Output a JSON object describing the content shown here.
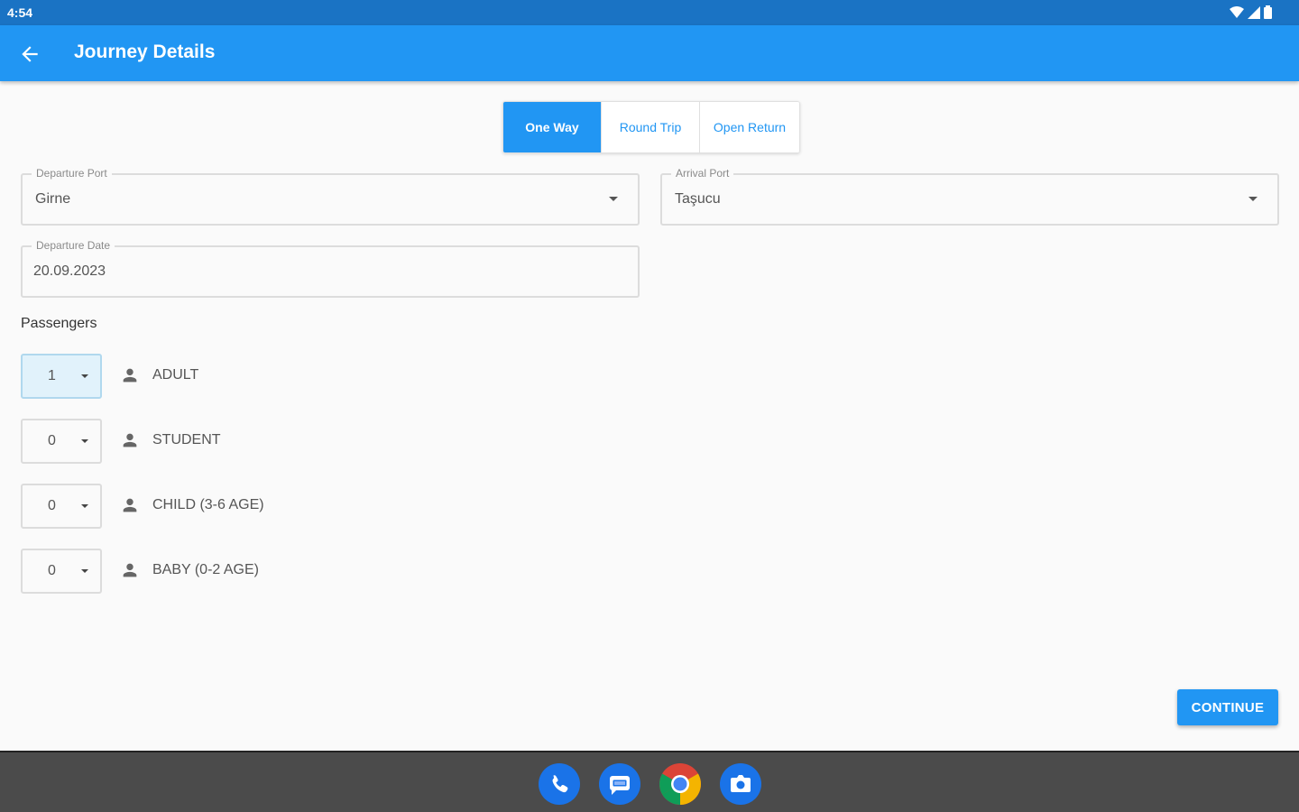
{
  "status_bar": {
    "time": "4:54"
  },
  "app_bar": {
    "title": "Journey Details"
  },
  "trip_types": [
    {
      "label": "One Way",
      "active": true
    },
    {
      "label": "Round Trip",
      "active": false
    },
    {
      "label": "Open Return",
      "active": false
    }
  ],
  "departure_port": {
    "label": "Departure Port",
    "value": "Girne"
  },
  "arrival_port": {
    "label": "Arrival Port",
    "value": "Taşucu"
  },
  "departure_date": {
    "label": "Departure Date",
    "value": "20.09.2023"
  },
  "passengers": {
    "title": "Passengers",
    "rows": [
      {
        "count": "1",
        "label": "ADULT"
      },
      {
        "count": "0",
        "label": "STUDENT"
      },
      {
        "count": "0",
        "label": "CHILD (3-6 AGE)"
      },
      {
        "count": "0",
        "label": "BABY (0-2 AGE)"
      }
    ]
  },
  "continue_label": "CONTINUE",
  "colors": {
    "primary": "#2196f3",
    "status_bar": "#1a73c4",
    "nav_bar": "#4b4b4b",
    "selected_bg": "#e1f2fb"
  },
  "dock": [
    "phone-icon",
    "messages-icon",
    "chrome-icon",
    "camera-icon"
  ]
}
